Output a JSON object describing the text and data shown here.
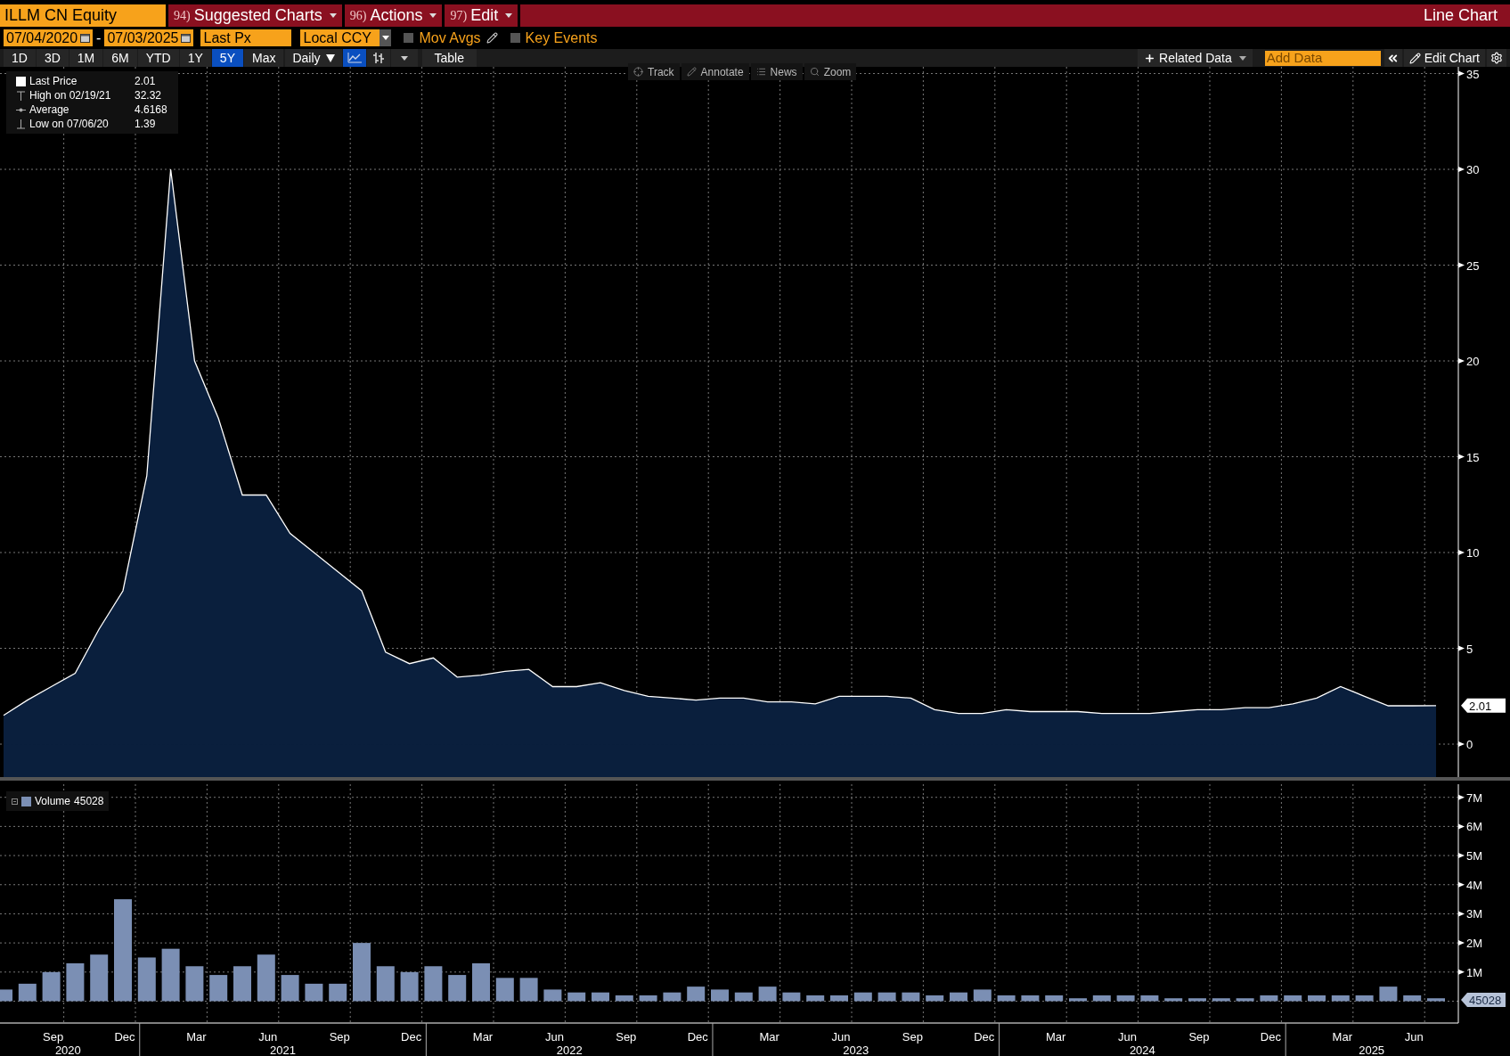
{
  "header": {
    "security": "ILLM CN Equity",
    "menus": [
      {
        "number": "94)",
        "label": "Suggested Charts"
      },
      {
        "number": "96)",
        "label": "Actions"
      },
      {
        "number": "97)",
        "label": "Edit"
      }
    ],
    "title": "Line Chart"
  },
  "controls": {
    "start_date": "07/04/2020",
    "separator": "-",
    "end_date": "07/03/2025",
    "field": "Last Px",
    "currency": "Local CCY",
    "toggles": [
      {
        "kind": "mov_avgs",
        "label": "Mov Avgs",
        "checked": false
      },
      {
        "kind": "key_events",
        "label": "Key Events",
        "checked": false
      }
    ]
  },
  "toolbar": {
    "periods": [
      {
        "label": "1D",
        "selected": false
      },
      {
        "label": "3D",
        "selected": false
      },
      {
        "label": "1M",
        "selected": false
      },
      {
        "label": "6M",
        "selected": false
      },
      {
        "label": "YTD",
        "selected": false
      },
      {
        "label": "1Y",
        "selected": false
      },
      {
        "label": "5Y",
        "selected": true
      },
      {
        "label": "Max",
        "selected": false
      }
    ],
    "frequency": "Daily",
    "chart_styles": [
      {
        "kind": "line",
        "selected": true
      },
      {
        "kind": "bar",
        "selected": false
      }
    ],
    "table": "Table",
    "related_data": "Related Data",
    "add_data_placeholder": "Add Data",
    "edit_chart": "Edit Chart"
  },
  "chart_tools": [
    {
      "kind": "track",
      "label": "Track"
    },
    {
      "kind": "annotate",
      "label": "Annotate"
    },
    {
      "kind": "news",
      "label": "News"
    },
    {
      "kind": "zoom",
      "label": "Zoom"
    }
  ],
  "price_panel": {
    "legend": [
      {
        "kind": "last",
        "value": "2.01"
      },
      {
        "kind": "high",
        "label": "High on 02/19/21",
        "value": "32.32"
      },
      {
        "kind": "average",
        "label": "Average",
        "value": "4.6168"
      },
      {
        "kind": "low",
        "label": "Low on 07/06/20",
        "value": "1.39"
      }
    ],
    "last_tag": "2.01",
    "chart_data": {
      "type": "area",
      "grid": true,
      "series": [
        {
          "name": "Last Price",
          "color": "#ffffff",
          "values": [
            1.5,
            2.3,
            3,
            3.7,
            6,
            8,
            14,
            30,
            20,
            17,
            13,
            13,
            11,
            10,
            9,
            8,
            4.8,
            4.2,
            4.5,
            3.5,
            3.6,
            3.8,
            3.9,
            3,
            3,
            3.2,
            2.8,
            2.5,
            2.4,
            2.3,
            2.4,
            2.4,
            2.2,
            2.2,
            2.1,
            2.5,
            2.5,
            2.5,
            2.4,
            1.8,
            1.6,
            1.6,
            1.8,
            1.7,
            1.7,
            1.7,
            1.6,
            1.6,
            1.6,
            1.7,
            1.8,
            1.8,
            1.9,
            1.9,
            2.1,
            2.4,
            3,
            2.5,
            2,
            2,
            2.01
          ]
        }
      ],
      "ylim": [
        -1.72,
        35.35
      ],
      "yticks": [
        0,
        5,
        10,
        15,
        20,
        25,
        30,
        35
      ]
    }
  },
  "volume_panel": {
    "legend": {
      "value": "45028"
    },
    "last_tag": "45028",
    "chart_data": {
      "type": "bar",
      "grid": true,
      "categories": [
        null,
        null,
        "Sep",
        null,
        null,
        "Dec",
        null,
        null,
        "Mar",
        null,
        null,
        "Jun",
        null,
        null,
        "Sep",
        null,
        null,
        "Dec",
        null,
        null,
        "Mar",
        null,
        null,
        "Jun",
        null,
        null,
        "Sep",
        null,
        null,
        "Dec",
        null,
        null,
        "Mar",
        null,
        null,
        "Jun",
        null,
        null,
        "Sep",
        null,
        null,
        "Dec",
        null,
        null,
        "Mar",
        null,
        null,
        "Jun",
        null,
        null,
        "Sep",
        null,
        null,
        "Dec",
        null,
        null,
        "Mar",
        null,
        null,
        "Jun",
        null
      ],
      "series": [
        {
          "name": "Volume",
          "color": "#7b8fb4",
          "values": [
            0.4,
            0.6,
            1,
            1.3,
            1.6,
            3.5,
            1.5,
            1.8,
            1.2,
            0.9,
            1.2,
            1.6,
            0.9,
            0.6,
            0.6,
            2,
            1.2,
            1,
            1.2,
            0.9,
            1.3,
            0.8,
            0.8,
            0.4,
            0.3,
            0.3,
            0.2,
            0.2,
            0.3,
            0.5,
            0.4,
            0.3,
            0.5,
            0.3,
            0.2,
            0.2,
            0.3,
            0.3,
            0.3,
            0.2,
            0.3,
            0.4,
            0.2,
            0.2,
            0.2,
            0.1,
            0.2,
            0.2,
            0.2,
            0.1,
            0.1,
            0.1,
            0.1,
            0.2,
            0.2,
            0.2,
            0.2,
            0.2,
            0.5,
            0.2,
            0.1
          ]
        }
      ],
      "ylim": [
        -0.75,
        7.45
      ],
      "yticks": [
        {
          "value": 1,
          "label": "1M"
        },
        {
          "value": 2,
          "label": "2M"
        },
        {
          "value": 3,
          "label": "3M"
        },
        {
          "value": 4,
          "label": "4M"
        },
        {
          "value": 5,
          "label": "5M"
        },
        {
          "value": 6,
          "label": "6M"
        },
        {
          "value": 7,
          "label": "7M"
        }
      ]
    },
    "years": [
      "2020",
      "2021",
      "2022",
      "2023",
      "2024",
      "2025"
    ]
  }
}
